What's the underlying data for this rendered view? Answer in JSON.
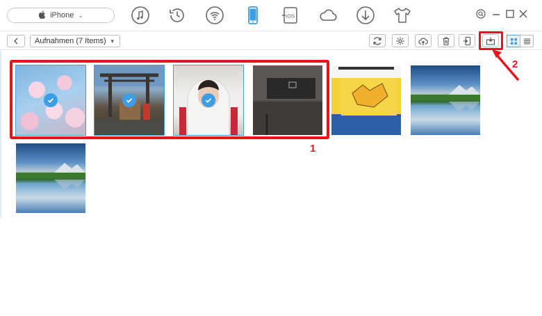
{
  "device": {
    "name": "iPhone"
  },
  "top_icons": [
    "music-icon",
    "history-icon",
    "wifi-icon",
    "phone-icon",
    "ios-transfer-icon",
    "cloud-icon",
    "download-icon",
    "shirt-icon"
  ],
  "top_icon_labels": {
    "ios": "iOS"
  },
  "window_controls": [
    "search-icon",
    "minimize-icon",
    "maximize-icon",
    "close-icon"
  ],
  "toolbar": {
    "album_label": "Aufnahmen (7 Items)",
    "buttons": [
      "refresh-icon",
      "settings-icon",
      "upload-icon",
      "delete-icon",
      "export-to-device-icon",
      "export-to-computer-icon"
    ],
    "view_modes": [
      "grid-view-icon",
      "list-view-icon"
    ],
    "active_view": "grid"
  },
  "photos": [
    {
      "subject": "cherry blossoms",
      "selected": true
    },
    {
      "subject": "shrine gate",
      "selected": true
    },
    {
      "subject": "person in hoodie",
      "selected": true
    },
    {
      "subject": "switch console",
      "selected": false
    },
    {
      "subject": "manga book",
      "selected": false
    },
    {
      "subject": "mountain lake",
      "selected": false
    },
    {
      "subject": "mountain lake",
      "selected": false
    }
  ],
  "annotations": {
    "step1": "1",
    "step2": "2"
  },
  "colors": {
    "accent": "#3d9ee6",
    "highlight": "#e8141c"
  }
}
